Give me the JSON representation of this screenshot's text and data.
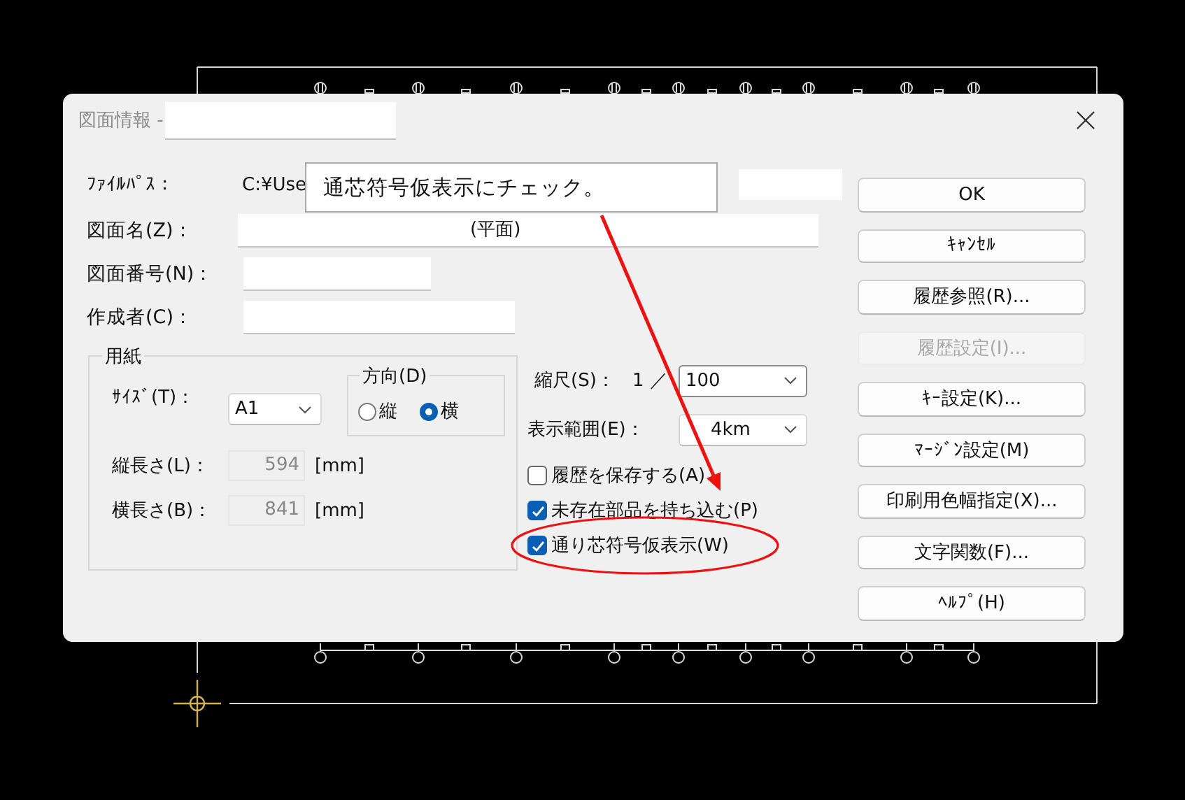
{
  "window": {
    "title": "図面情報 - "
  },
  "fields": [
    {
      "label": "ﾌｧｲﾙﾊﾟｽ：",
      "kind": "path",
      "value": "C:¥Use"
    },
    {
      "label": "図面名(Z)：",
      "kind": "name",
      "value": "(平面)"
    },
    {
      "label": "図面番号(N)：",
      "kind": "number"
    },
    {
      "label": "作成者(C)：",
      "kind": "author"
    }
  ],
  "paper": {
    "legend": "用紙",
    "size": {
      "label": "ｻｲｽﾞ(T)：",
      "value": "A1"
    },
    "orientation": {
      "legend": "方向(D)",
      "options": [
        {
          "label": "縦",
          "selected": false
        },
        {
          "label": "横",
          "selected": true
        }
      ]
    },
    "dims": [
      {
        "label": "縦長さ(L)：",
        "value": "594",
        "unit": "[mm]"
      },
      {
        "label": "横長さ(B)：",
        "value": "841",
        "unit": "[mm]"
      }
    ]
  },
  "scale": {
    "label": "縮尺(S)：",
    "prefix": "1 ／",
    "value": "100"
  },
  "range": {
    "label": "表示範囲(E)：",
    "value": "4km"
  },
  "checks": [
    {
      "label": "履歴を保存する(A)",
      "checked": false
    },
    {
      "label": "未存在部品を持ち込む(P)",
      "checked": true
    },
    {
      "label": "通り芯符号仮表示(W)",
      "checked": true
    }
  ],
  "buttons": [
    {
      "label": "OK",
      "disabled": false
    },
    {
      "label": "ｷｬﾝｾﾙ",
      "disabled": false
    },
    {
      "label": "履歴参照(R)...",
      "disabled": false
    },
    {
      "label": "履歴設定(I)...",
      "disabled": true
    },
    {
      "label": "ｷｰ設定(K)...",
      "disabled": false
    },
    {
      "label": "ﾏｰｼﾞﾝ設定(M)",
      "disabled": false
    },
    {
      "label": "印刷用色幅指定(X)...",
      "disabled": false
    },
    {
      "label": "文字関数(F)...",
      "disabled": false
    },
    {
      "label": "ﾍﾙﾌﾟ(H)",
      "disabled": false
    }
  ],
  "annotation": {
    "text": "通芯符号仮表示にチェック。"
  }
}
